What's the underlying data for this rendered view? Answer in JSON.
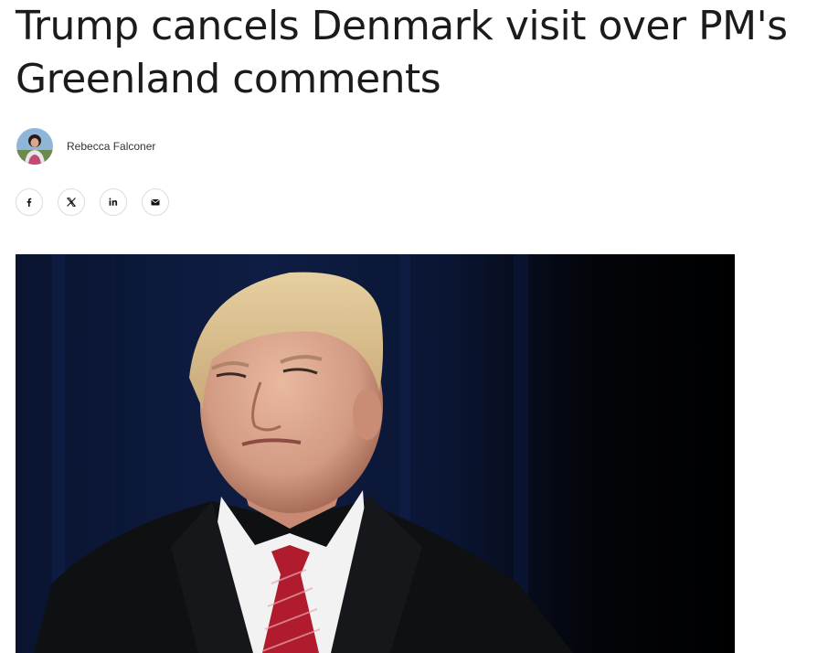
{
  "article": {
    "headline": "Trump cancels Denmark visit over PM's Greenland comments",
    "author": {
      "name": "Rebecca Falconer",
      "avatar_icon": "author-avatar"
    }
  },
  "share": {
    "buttons": [
      {
        "name": "facebook",
        "icon": "facebook-icon"
      },
      {
        "name": "x",
        "icon": "x-icon"
      },
      {
        "name": "linkedin",
        "icon": "linkedin-icon"
      },
      {
        "name": "email",
        "icon": "mail-icon"
      }
    ]
  },
  "hero_image": {
    "subject": "portrait photo",
    "colors": {
      "background": "#05070d",
      "curtain": "#0d1a3a",
      "suit": "#0f1012",
      "shirt": "#f2f2f2",
      "tie": "#b01c2e"
    }
  }
}
